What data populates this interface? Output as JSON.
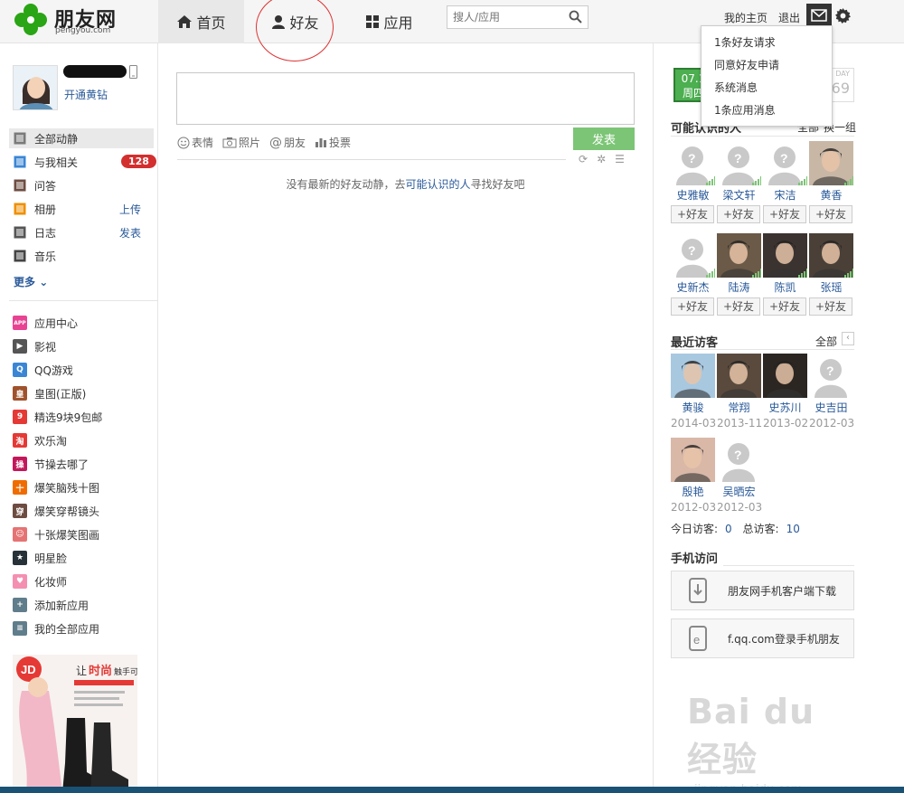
{
  "brand": {
    "name": "朋友网",
    "domain": "pengyou.com",
    "clover_color": "#2aa515"
  },
  "nav": {
    "tabs": [
      {
        "label": "首页",
        "icon": "home-icon",
        "active": true
      },
      {
        "label": "好友",
        "icon": "person-icon",
        "active": false
      },
      {
        "label": "应用",
        "icon": "apps-grid-icon",
        "active": false
      }
    ],
    "search_placeholder": "搜人/应用",
    "my_home": "我的主页",
    "logout": "退出"
  },
  "dropdown": [
    "1条好友请求",
    "同意好友申请",
    "系统消息",
    "1条应用消息"
  ],
  "profile": {
    "vip_link": "开通黄钻"
  },
  "left_menu": [
    {
      "label": "全部动静",
      "icon": "feed-icon",
      "active": true,
      "extra": ""
    },
    {
      "label": "与我相关",
      "icon": "mention-icon",
      "badge": "128",
      "extra": ""
    },
    {
      "label": "问答",
      "icon": "qa-icon",
      "extra": ""
    },
    {
      "label": "相册",
      "icon": "photo-album-icon",
      "extra": "上传"
    },
    {
      "label": "日志",
      "icon": "blog-icon",
      "extra": "发表"
    },
    {
      "label": "音乐",
      "icon": "music-icon",
      "extra": ""
    }
  ],
  "more_label": "更多",
  "apps": [
    {
      "label": "应用中心",
      "icon": "app-center-icon",
      "color": "#e84393",
      "glyph": "APP"
    },
    {
      "label": "影视",
      "icon": "video-icon",
      "color": "#555555",
      "glyph": "▶"
    },
    {
      "label": "QQ游戏",
      "icon": "qq-game-icon",
      "color": "#3a86d4",
      "glyph": "Q"
    },
    {
      "label": "皇图(正版)",
      "icon": "huangtu-icon",
      "color": "#a0522d",
      "glyph": "皇"
    },
    {
      "label": "精选9块9包邮",
      "icon": "jingxuan-icon",
      "color": "#e53935",
      "glyph": "9"
    },
    {
      "label": "欢乐淘",
      "icon": "huanletao-icon",
      "color": "#e53935",
      "glyph": "淘"
    },
    {
      "label": "节操去哪了",
      "icon": "jiecao-icon",
      "color": "#c2185b",
      "glyph": "操"
    },
    {
      "label": "爆笑脑残十图",
      "icon": "naocan-icon",
      "color": "#ef6c00",
      "glyph": "十"
    },
    {
      "label": "爆笑穿帮镜头",
      "icon": "chuanbang-icon",
      "color": "#6d4c41",
      "glyph": "穿"
    },
    {
      "label": "十张爆笑图画",
      "icon": "tuhua-icon",
      "color": "#e57373",
      "glyph": "☺"
    },
    {
      "label": "明星脸",
      "icon": "star-face-icon",
      "color": "#263238",
      "glyph": "★"
    },
    {
      "label": "化妆师",
      "icon": "makeup-icon",
      "color": "#f48fb1",
      "glyph": "♥"
    },
    {
      "label": "添加新应用",
      "icon": "add-app-icon",
      "color": "#607d8b",
      "glyph": "+"
    },
    {
      "label": "我的全部应用",
      "icon": "all-apps-icon",
      "color": "#607d8b",
      "glyph": "≡"
    }
  ],
  "ad": {
    "brand": "JD",
    "headline_1": "让",
    "headline_2": "时尚",
    "headline_3": "触手可"
  },
  "compose": {
    "tools": [
      {
        "label": "表情",
        "icon": "emoji-icon"
      },
      {
        "label": "照片",
        "icon": "camera-icon"
      },
      {
        "label": "朋友",
        "icon": "at-icon"
      },
      {
        "label": "投票",
        "icon": "vote-icon"
      }
    ],
    "post_label": "发表",
    "empty_prefix": "没有最新的好友动静，去",
    "empty_link": "可能认识的人",
    "empty_suffix": "寻找好友吧"
  },
  "calendar": {
    "date": "07.1",
    "weekday": "周四",
    "day_label": "DAY",
    "day_num": "69"
  },
  "suggest": {
    "title": "可能认识的人",
    "all": "全部",
    "refresh": "换一组",
    "add_label": "+好友",
    "people": [
      {
        "name": "史雅敏",
        "photo": false
      },
      {
        "name": "梁文轩",
        "photo": false
      },
      {
        "name": "宋洁",
        "photo": false
      },
      {
        "name": "黄香",
        "photo": true,
        "color": "#c9b7a6"
      },
      {
        "name": "史新杰",
        "photo": false
      },
      {
        "name": "陆涛",
        "photo": true,
        "color": "#6b5a48"
      },
      {
        "name": "陈凯",
        "photo": true,
        "color": "#3b3330"
      },
      {
        "name": "张瑶",
        "photo": true,
        "color": "#4a4038"
      }
    ]
  },
  "visitors": {
    "title": "最近访客",
    "all": "全部",
    "people": [
      {
        "name": "黄骏",
        "date": "2014-03-",
        "photo": true,
        "color": "#a8c8e0"
      },
      {
        "name": "常翔",
        "date": "2013-11-",
        "photo": true,
        "color": "#5a4a3e"
      },
      {
        "name": "史苏川",
        "date": "2013-02-",
        "photo": true,
        "color": "#2b2622"
      },
      {
        "name": "史吉田",
        "date": "2012-03-",
        "photo": false
      },
      {
        "name": "殷艳",
        "date": "2012-03-",
        "photo": true,
        "color": "#d9b8a8"
      },
      {
        "name": "吴晒宏",
        "date": "2012-03-",
        "photo": false
      }
    ],
    "today_label": "今日访客:",
    "today_count": "0",
    "total_label": "总访客:",
    "total_count": "10"
  },
  "mobile": {
    "title": "手机访问",
    "client_download": "朋友网手机客户端下载",
    "fqq": "f.qq.com登录手机朋友"
  },
  "watermark": {
    "line1": "Bai du 经验",
    "line2": "jingyan.baidu.com"
  }
}
